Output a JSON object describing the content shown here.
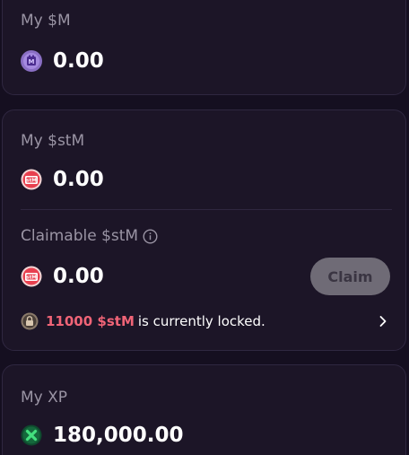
{
  "my_m": {
    "label": "My $M",
    "value": "0.00",
    "icon": "m-token-icon"
  },
  "my_stm": {
    "label": "My $stM",
    "value": "0.00",
    "icon": "stm-token-icon"
  },
  "claimable_stm": {
    "label": "Claimable $stM",
    "info_icon": "info-icon",
    "value": "0.00",
    "icon": "stm-token-icon",
    "claim_label": "Claim"
  },
  "locked": {
    "amount": "11000 $stM",
    "text": "is currently locked.",
    "icon": "lock-icon",
    "chevron_icon": "chevron-right-icon"
  },
  "my_xp": {
    "label": "My XP",
    "value": "180,000.00",
    "icon": "xp-icon"
  },
  "colors": {
    "background": "#150f20",
    "card": "#1c1527",
    "card_border": "#2f2740",
    "label": "#9a94a4",
    "locked_accent": "#f06477",
    "claim_button_disabled": "#6f6b76",
    "m_icon": "#8a6fc4",
    "stm_icon": "#e8404f",
    "xp_icon": "#1aa05a"
  }
}
